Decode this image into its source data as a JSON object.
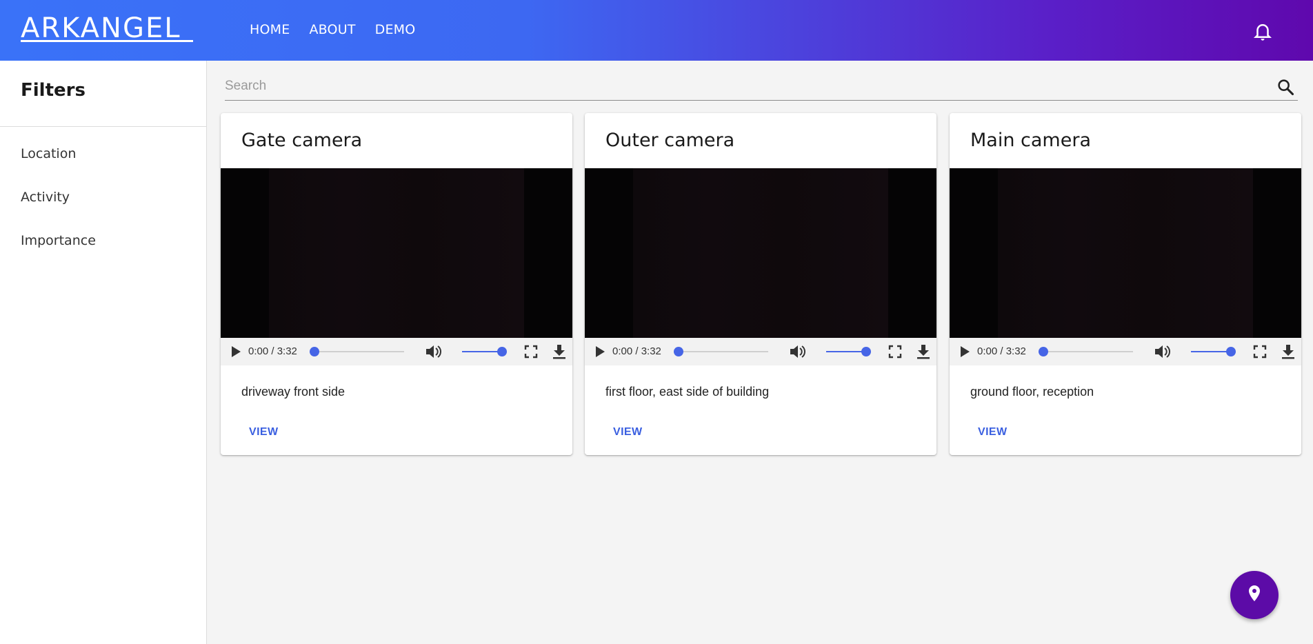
{
  "app": {
    "logo_text": "ARKANGEL",
    "nav": [
      {
        "label": "HOME"
      },
      {
        "label": "ABOUT"
      },
      {
        "label": "DEMO"
      }
    ],
    "icons": {
      "notifications": "bell-icon",
      "fab": "location-pin-icon"
    }
  },
  "sidebar": {
    "title": "Filters",
    "items": [
      {
        "label": "Location"
      },
      {
        "label": "Activity"
      },
      {
        "label": "Importance"
      }
    ]
  },
  "search": {
    "placeholder": "Search",
    "value": ""
  },
  "cameras": [
    {
      "title": "Gate camera",
      "description": "driveway front side",
      "time": "0:00 / 3:32",
      "progress": 0,
      "volume": 1.0,
      "action_label": "VIEW"
    },
    {
      "title": "Outer camera",
      "description": "first floor, east side of building",
      "time": "0:00 / 3:32",
      "progress": 0,
      "volume": 1.0,
      "action_label": "VIEW"
    },
    {
      "title": "Main camera",
      "description": "ground floor, reception",
      "time": "0:00 / 3:32",
      "progress": 0,
      "volume": 1.0,
      "action_label": "VIEW"
    }
  ],
  "colors": {
    "header_gradient_start": "#3a72f8",
    "header_gradient_end": "#5f08ad",
    "accent": "#4665e6",
    "fab": "#5c0ba7",
    "link": "#3a5fe0"
  }
}
